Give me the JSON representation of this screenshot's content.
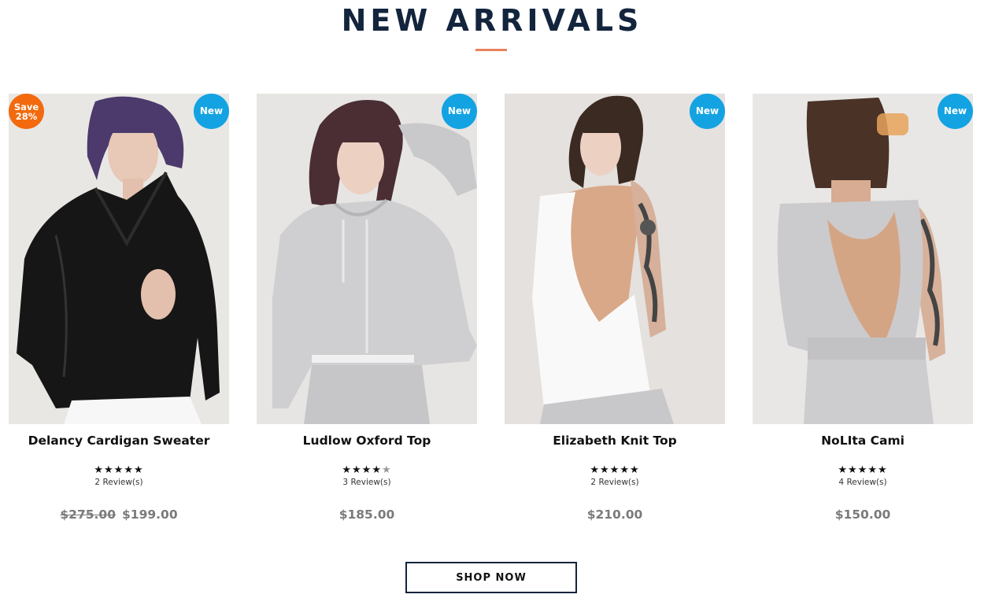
{
  "section": {
    "title": "NEW ARRIVALS",
    "accent_color": "#e9825d",
    "title_color": "#13243d"
  },
  "products": [
    {
      "name": "Delancy Cardigan Sweater",
      "badge_new": "New",
      "badge_sale_line1": "Save",
      "badge_sale_line2": "28%",
      "rating": 5,
      "stars": "★★★★★",
      "reviews": "2 Review(s)",
      "old_price": "$275.00",
      "price": "$199.00",
      "image_icon": "model-leather-jacket"
    },
    {
      "name": "Ludlow Oxford Top",
      "badge_new": "New",
      "rating": 4.5,
      "stars": "★★★★",
      "stars_half": "★",
      "reviews": "3 Review(s)",
      "price": "$185.00",
      "image_icon": "model-grey-hoodie"
    },
    {
      "name": "Elizabeth Knit Top",
      "badge_new": "New",
      "rating": 5,
      "stars": "★★★★★",
      "reviews": "2 Review(s)",
      "price": "$210.00",
      "image_icon": "model-white-open-back-top"
    },
    {
      "name": "NoLIta Cami",
      "badge_new": "New",
      "rating": 5,
      "stars": "★★★★★",
      "reviews": "4 Review(s)",
      "price": "$150.00",
      "image_icon": "model-grey-open-back-cami"
    }
  ],
  "cta": {
    "label": "SHOP NOW"
  },
  "colors": {
    "badge_new": "#13a3e2",
    "badge_sale": "#f26a0d",
    "price": "#7a7a7a"
  }
}
